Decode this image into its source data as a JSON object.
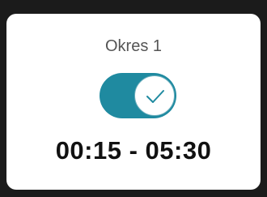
{
  "card": {
    "title": "Okres 1",
    "toggle": {
      "state": "on",
      "accent_color": "#1f8aa0",
      "icon": "checkmark-icon"
    },
    "time_range": "00:15 - 05:30"
  }
}
